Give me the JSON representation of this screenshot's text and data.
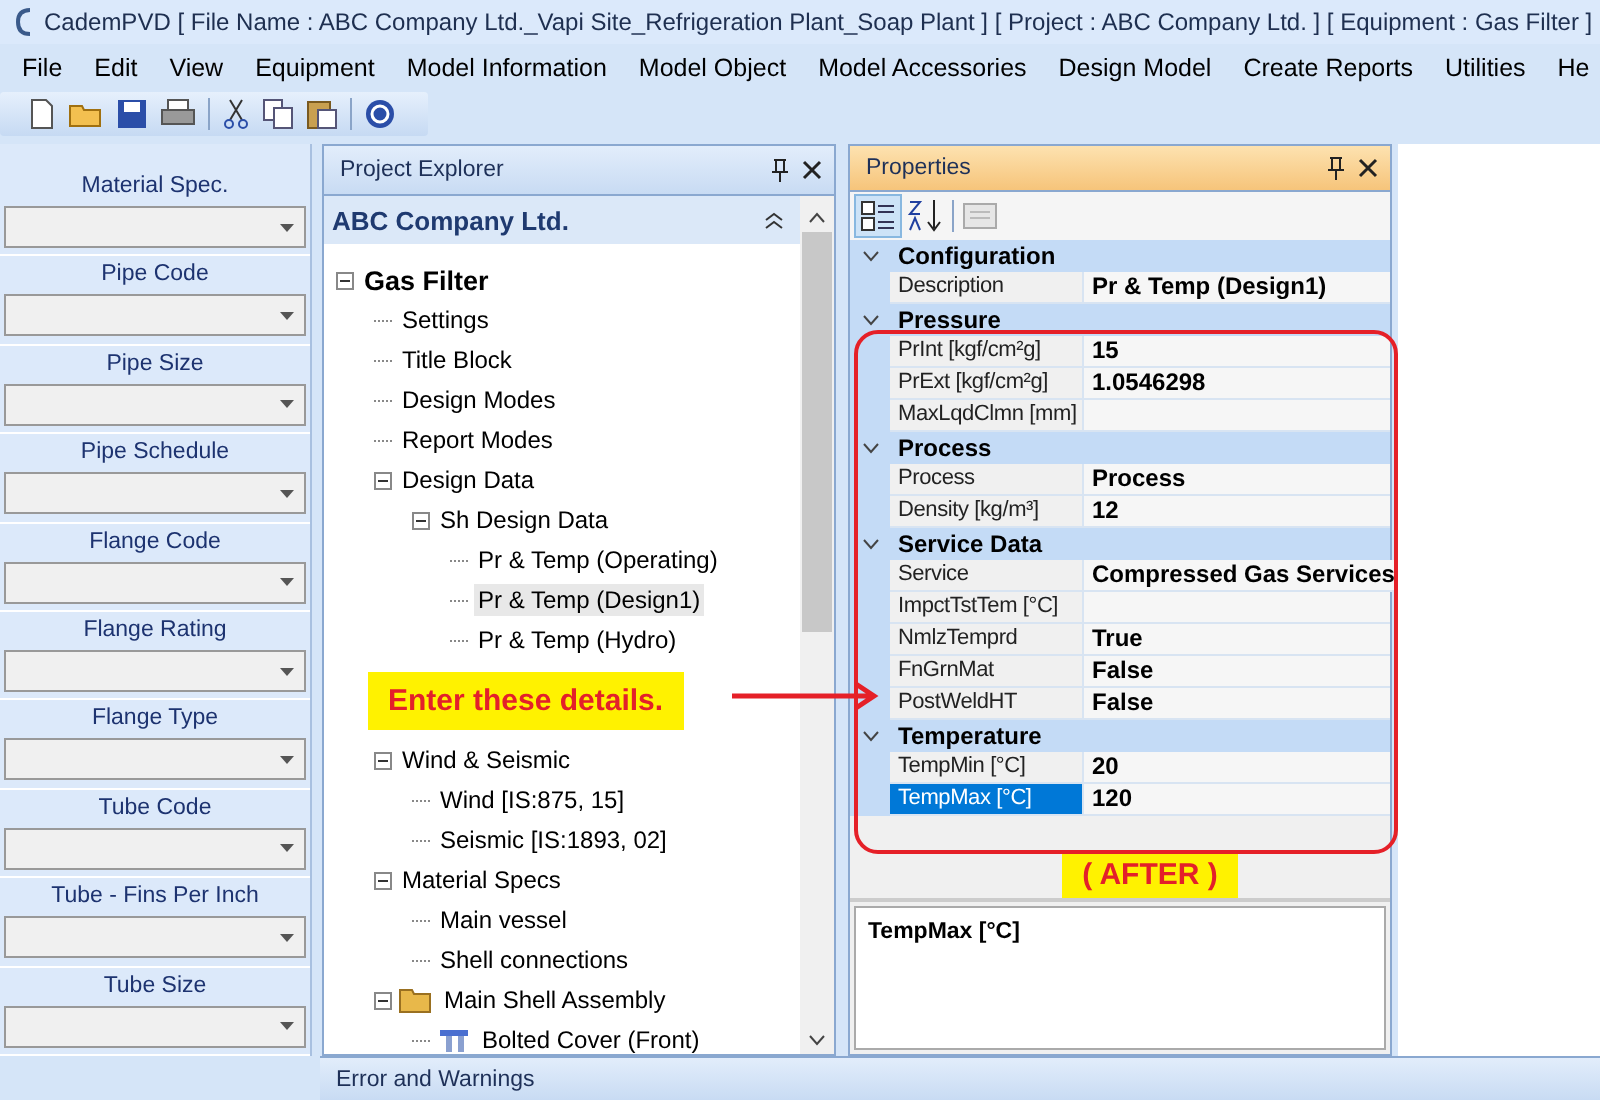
{
  "window": {
    "title": "CademPVD [ File Name : ABC Company Ltd._Vapi Site_Refrigeration Plant_Soap Plant ] [ Project : ABC Company Ltd. ] [ Equipment : Gas Filter ]"
  },
  "menu": [
    "File",
    "Edit",
    "View",
    "Equipment",
    "Model Information",
    "Model Object",
    "Model Accessories",
    "Design Model",
    "Create Reports",
    "Utilities",
    "He"
  ],
  "left_panel": {
    "fields": [
      {
        "label": "Material Spec."
      },
      {
        "label": "Pipe Code"
      },
      {
        "label": "Pipe Size"
      },
      {
        "label": "Pipe Schedule"
      },
      {
        "label": "Flange Code"
      },
      {
        "label": "Flange Rating"
      },
      {
        "label": "Flange Type"
      },
      {
        "label": "Tube Code"
      },
      {
        "label": "Tube - Fins Per Inch"
      },
      {
        "label": "Tube Size"
      }
    ]
  },
  "explorer": {
    "title": "Project Explorer",
    "header": "ABC Company Ltd.",
    "tree": [
      {
        "label": "Gas Filter",
        "selected": false,
        "expanded": true,
        "children": [
          {
            "label": "Settings",
            "selected": false
          },
          {
            "label": "Title Block",
            "selected": false
          },
          {
            "label": "Design Modes",
            "selected": false
          },
          {
            "label": "Report Modes",
            "selected": false
          },
          {
            "label": "Design Data",
            "selected": false,
            "expanded": true,
            "children": [
              {
                "label": "Sh Design Data",
                "selected": false,
                "expanded": true,
                "children": [
                  {
                    "label": "Pr & Temp (Operating)",
                    "selected": false
                  },
                  {
                    "label": "Pr & Temp (Design1)",
                    "selected": true
                  },
                  {
                    "label": "Pr & Temp (Hydro)",
                    "selected": false
                  }
                ]
              }
            ]
          },
          {
            "label": "Wind & Seismic",
            "selected": false,
            "expanded": true,
            "children": [
              {
                "label": "Wind [IS:875, 15]",
                "selected": false
              },
              {
                "label": "Seismic [IS:1893, 02]",
                "selected": false
              }
            ]
          },
          {
            "label": "Material Specs",
            "selected": false,
            "expanded": true,
            "children": [
              {
                "label": "Main vessel",
                "selected": false
              },
              {
                "label": "Shell connections",
                "selected": false
              }
            ]
          },
          {
            "label": "Main Shell Assembly",
            "kind": "folder",
            "selected": false,
            "expanded": true,
            "children": [
              {
                "label": "Bolted Cover (Front)",
                "kind": "part",
                "selected": false
              }
            ]
          }
        ]
      }
    ]
  },
  "properties": {
    "title": "Properties",
    "categories": [
      {
        "name": "Configuration",
        "expanded": true,
        "rows": [
          {
            "name": "Description",
            "value": "Pr & Temp (Design1)",
            "selected": false
          }
        ]
      },
      {
        "name": "Pressure",
        "expanded": true,
        "rows": [
          {
            "name": "PrInt [kgf/cm²g]",
            "value": "15",
            "selected": false
          },
          {
            "name": "PrExt [kgf/cm²g]",
            "value": "1.0546298",
            "selected": false
          },
          {
            "name": "MaxLqdClmn [mm]",
            "value": "",
            "selected": false
          }
        ]
      },
      {
        "name": "Process",
        "expanded": true,
        "rows": [
          {
            "name": "Process",
            "value": "Process",
            "selected": false
          },
          {
            "name": "Density [kg/m³]",
            "value": "12",
            "selected": false
          }
        ]
      },
      {
        "name": "Service Data",
        "expanded": true,
        "rows": [
          {
            "name": "Service",
            "value": "Compressed Gas Services",
            "selected": false
          },
          {
            "name": "ImpctTstTem [°C]",
            "value": "",
            "selected": false
          },
          {
            "name": "NmlzTemprd",
            "value": "True",
            "selected": false
          },
          {
            "name": "FnGrnMat",
            "value": "False",
            "selected": false
          },
          {
            "name": "PostWeldHT",
            "value": "False",
            "selected": false
          }
        ]
      },
      {
        "name": "Temperature",
        "expanded": true,
        "rows": [
          {
            "name": "TempMin [°C]",
            "value": "20",
            "selected": false
          },
          {
            "name": "TempMax [°C]",
            "value": "120",
            "selected": true
          }
        ]
      }
    ],
    "description_title": "TempMax [°C]"
  },
  "annotations": {
    "callout": "Enter these details.",
    "after_label": "( AFTER )"
  },
  "bottom_panel": {
    "title": "Error and Warnings"
  }
}
